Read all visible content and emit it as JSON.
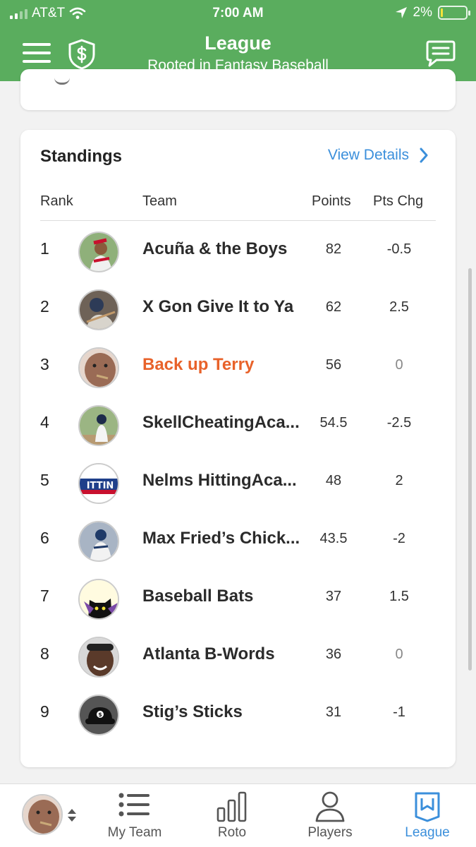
{
  "status_bar": {
    "carrier": "AT&T",
    "time": "7:00 AM",
    "battery": "2%",
    "battery_level": 0.02
  },
  "header": {
    "title": "League",
    "subtitle": "Rooted in Fantasy Baseball"
  },
  "standings": {
    "title": "Standings",
    "view_details": "View Details",
    "columns": {
      "rank": "Rank",
      "team": "Team",
      "points": "Points",
      "pts_chg": "Pts Chg"
    },
    "rows": [
      {
        "rank": "1",
        "team": "Acuña & the Boys",
        "points": "82",
        "pts_chg": "-0.5"
      },
      {
        "rank": "2",
        "team": "X Gon Give It to Ya",
        "points": "62",
        "pts_chg": "2.5"
      },
      {
        "rank": "3",
        "team": "Back up Terry",
        "points": "56",
        "pts_chg": "0"
      },
      {
        "rank": "4",
        "team": "SkellCheatingAca...",
        "points": "54.5",
        "pts_chg": "-2.5"
      },
      {
        "rank": "5",
        "team": "Nelms HittingAca...",
        "points": "48",
        "pts_chg": "2"
      },
      {
        "rank": "6",
        "team": "Max Fried’s Chick...",
        "points": "43.5",
        "pts_chg": "-2"
      },
      {
        "rank": "7",
        "team": "Baseball Bats",
        "points": "37",
        "pts_chg": "1.5"
      },
      {
        "rank": "8",
        "team": "Atlanta B-Words",
        "points": "36",
        "pts_chg": "0"
      },
      {
        "rank": "9",
        "team": "Stig’s Sticks",
        "points": "31",
        "pts_chg": "-1"
      }
    ]
  },
  "tabbar": {
    "items": [
      {
        "label": "My Team",
        "icon": "list-icon"
      },
      {
        "label": "Roto",
        "icon": "bar-chart-icon"
      },
      {
        "label": "Players",
        "icon": "person-icon"
      },
      {
        "label": "League",
        "icon": "bookmark-icon"
      }
    ],
    "active": "League"
  },
  "colors": {
    "brand_green": "#5aad5e",
    "link_blue": "#3b8fdb",
    "highlight_orange": "#e8622a"
  }
}
